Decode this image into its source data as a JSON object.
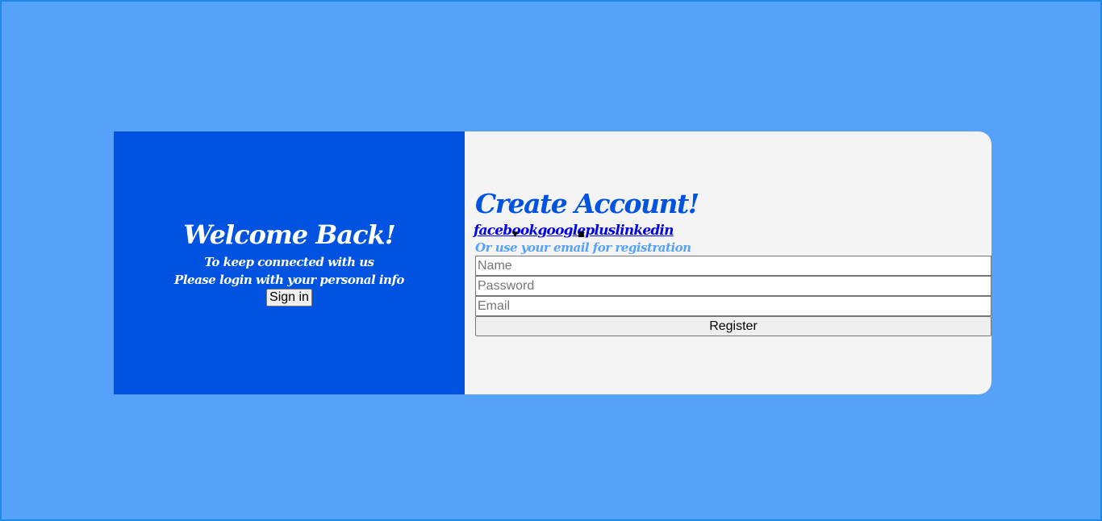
{
  "left_panel": {
    "title": "Welcome Back!",
    "line1": "To keep connected with us",
    "line2": "Please login with your personal info",
    "signin_label": "Sign in"
  },
  "right_panel": {
    "title": "Create Account!",
    "social_links": [
      "facebook",
      "googleplus",
      "linkedin"
    ],
    "note": "Or use your email for registration",
    "fields": {
      "name_placeholder": "Name",
      "password_placeholder": "Password",
      "email_placeholder": "Email"
    },
    "register_label": "Register"
  },
  "colors": {
    "page_bg": "#56a2fa",
    "accent": "#0052e0",
    "form_bg": "#f4f4f4",
    "link": "#0000ee"
  }
}
